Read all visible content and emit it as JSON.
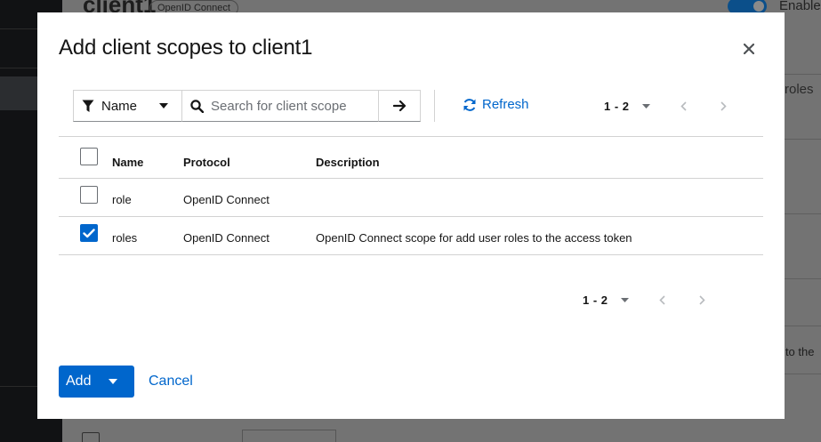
{
  "background": {
    "title": "client1",
    "badge": "OpenID Connect",
    "toggle_label": "Enable",
    "right_tab_fragment": "roles",
    "right_text_fragment": ") to the"
  },
  "modal": {
    "title": "Add client scopes to client1",
    "close_icon": "close-icon",
    "toolbar": {
      "filter_label": "Name",
      "search_placeholder": "Search for client scope",
      "search_value": "",
      "refresh_label": "Refresh"
    },
    "pagination_top": {
      "range": "1 - 2"
    },
    "pagination_bottom": {
      "range": "1 - 2"
    },
    "table": {
      "headers": {
        "name": "Name",
        "protocol": "Protocol",
        "description": "Description"
      },
      "rows": [
        {
          "name": "role",
          "protocol": "OpenID Connect",
          "description": "",
          "checked": false
        },
        {
          "name": "roles",
          "protocol": "OpenID Connect",
          "description": "OpenID Connect scope for add user roles to the access token",
          "checked": true
        }
      ]
    },
    "footer": {
      "add_label": "Add",
      "cancel_label": "Cancel"
    }
  },
  "colors": {
    "primary": "#0066cc",
    "backdrop": "#6b6b6b",
    "sidebar": "#111214"
  }
}
